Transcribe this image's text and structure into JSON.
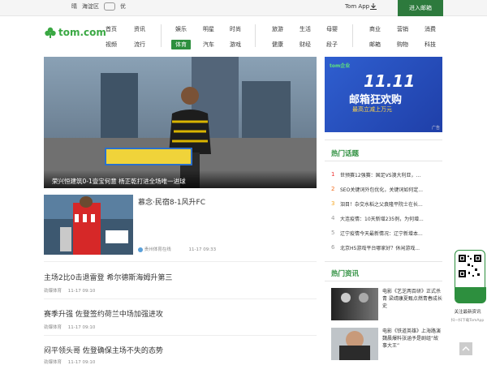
{
  "topbar": {
    "weather_text": "晴",
    "location": "海淀区",
    "air": "优",
    "tom_app": "Tom App",
    "mail_button": "进入邮箱"
  },
  "logo": {
    "text": "tom.com"
  },
  "nav": {
    "col1": [
      "首页",
      "视频"
    ],
    "col2": [
      "资讯",
      "流行"
    ],
    "col3": [
      "娱乐",
      "体育"
    ],
    "col4": [
      "明星",
      "汽车"
    ],
    "col5": [
      "时尚",
      "游戏"
    ],
    "col6": [
      "旅游",
      "健康"
    ],
    "col7": [
      "生活",
      "财经"
    ],
    "col8": [
      "母婴",
      "段子"
    ],
    "col9": [
      "商业",
      "邮箱"
    ],
    "col10": [
      "营销",
      "购物"
    ],
    "col11": [
      "消费",
      "科技"
    ],
    "active": "体育"
  },
  "hero": {
    "caption": "荣兴恒建筑0-1壹宝何意 杨正乾打进全场唯一进球"
  },
  "ad": {
    "logo": "tom企业",
    "big": "11.11",
    "sub": "邮箱狂欢购",
    "pill": "最高立减上万元",
    "tag": "广告"
  },
  "feature": {
    "title": "慕念·民宿8-1风升FC",
    "source": "贵州体育在线",
    "time": "11-17 09:33"
  },
  "articles": [
    {
      "title": "主场2比0击退雷登 希尔德斯海姆升第三",
      "source": "劲爆体育",
      "time": "11-17 09:10"
    },
    {
      "title": "赛季升强 佐登签约荷兰中场加强进攻",
      "source": "劲爆体育",
      "time": "11-17 09:10"
    },
    {
      "title": "闷平领头哥 佐登确保主场不失的态势",
      "source": "劲爆体育",
      "time": "11-17 09:10"
    }
  ],
  "hot_topics": {
    "title": "热门话题",
    "items": [
      {
        "num": "1",
        "text": "世预赛12强赛：国足VS澳大利亚，..."
      },
      {
        "num": "2",
        "text": "SEO关键词外包优化，关键词如何定..."
      },
      {
        "num": "3",
        "text": "泪目！杂交水稻之父袁隆平院士在长..."
      },
      {
        "num": "4",
        "text": "大连疫情：10天新增235例，为何增..."
      },
      {
        "num": "5",
        "text": "辽宁疫情今天最新情况：辽宁新增本..."
      },
      {
        "num": "6",
        "text": "北京H5游戏平台哪家好？休闲游戏..."
      }
    ]
  },
  "hot_info": {
    "title": "热门资讯",
    "items": [
      {
        "text": "电影《艺芝两百研》正式杀青 梁靖康夏甄点燃青春成长史"
      },
      {
        "text": "电影《铁道英雄》上海路演 魏晨爆料张涵予是剧组“故事大王”"
      }
    ]
  },
  "qr": {
    "label": "关注最新资讯",
    "sub": "扫一扫下载TomApp"
  },
  "colors": {
    "brand_green": "#2d8f3e",
    "rank1": "#e33",
    "rank2": "#f26a1b",
    "rank3": "#f5a623"
  }
}
